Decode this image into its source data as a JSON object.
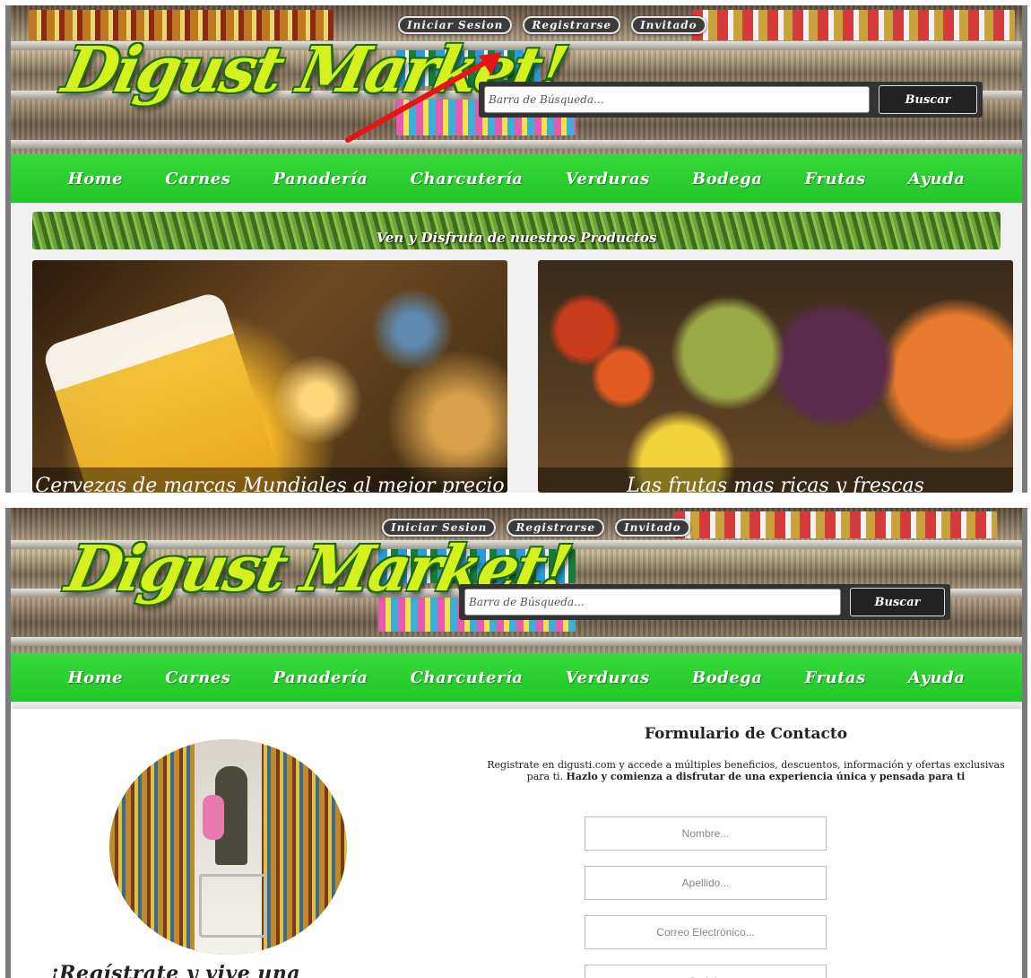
{
  "header": {
    "logo_text": "Digust Market!",
    "top_links": [
      "Iniciar Sesion",
      "Registrarse",
      "Invitado"
    ],
    "search_placeholder": "Barra de Búsqueda...",
    "search_button": "Buscar"
  },
  "nav": {
    "items": [
      "Home",
      "Carnes",
      "Panadería",
      "Charcutería",
      "Verduras",
      "Bodega",
      "Frutas",
      "Ayuda"
    ]
  },
  "home": {
    "banner": "Ven y Disfruta de nuestros Productos",
    "tiles": [
      {
        "caption": "Cervezas de marcas Mundiales al mejor precio"
      },
      {
        "caption": "Las frutas mas ricas y frescas"
      }
    ]
  },
  "register": {
    "tagline": "¡Regístrate y vive una experiencia única!",
    "form_title": "Formulario de Contacto",
    "desc_plain": "Registrate en digusti.com y accede a múltiples beneficios, descuentos, información y ofertas exclusivas para ti.",
    "desc_bold": "Hazlo y comienza a disfrutar de una experiencia única y pensada para ti",
    "fields": [
      "Nombre...",
      "Apellido...",
      "Correo Electrónico...",
      "Cedula"
    ]
  },
  "colors": {
    "nav_green": "#26cd2c",
    "logo_yellow": "#d4f11d",
    "annotation_arrow": "#e81414"
  }
}
